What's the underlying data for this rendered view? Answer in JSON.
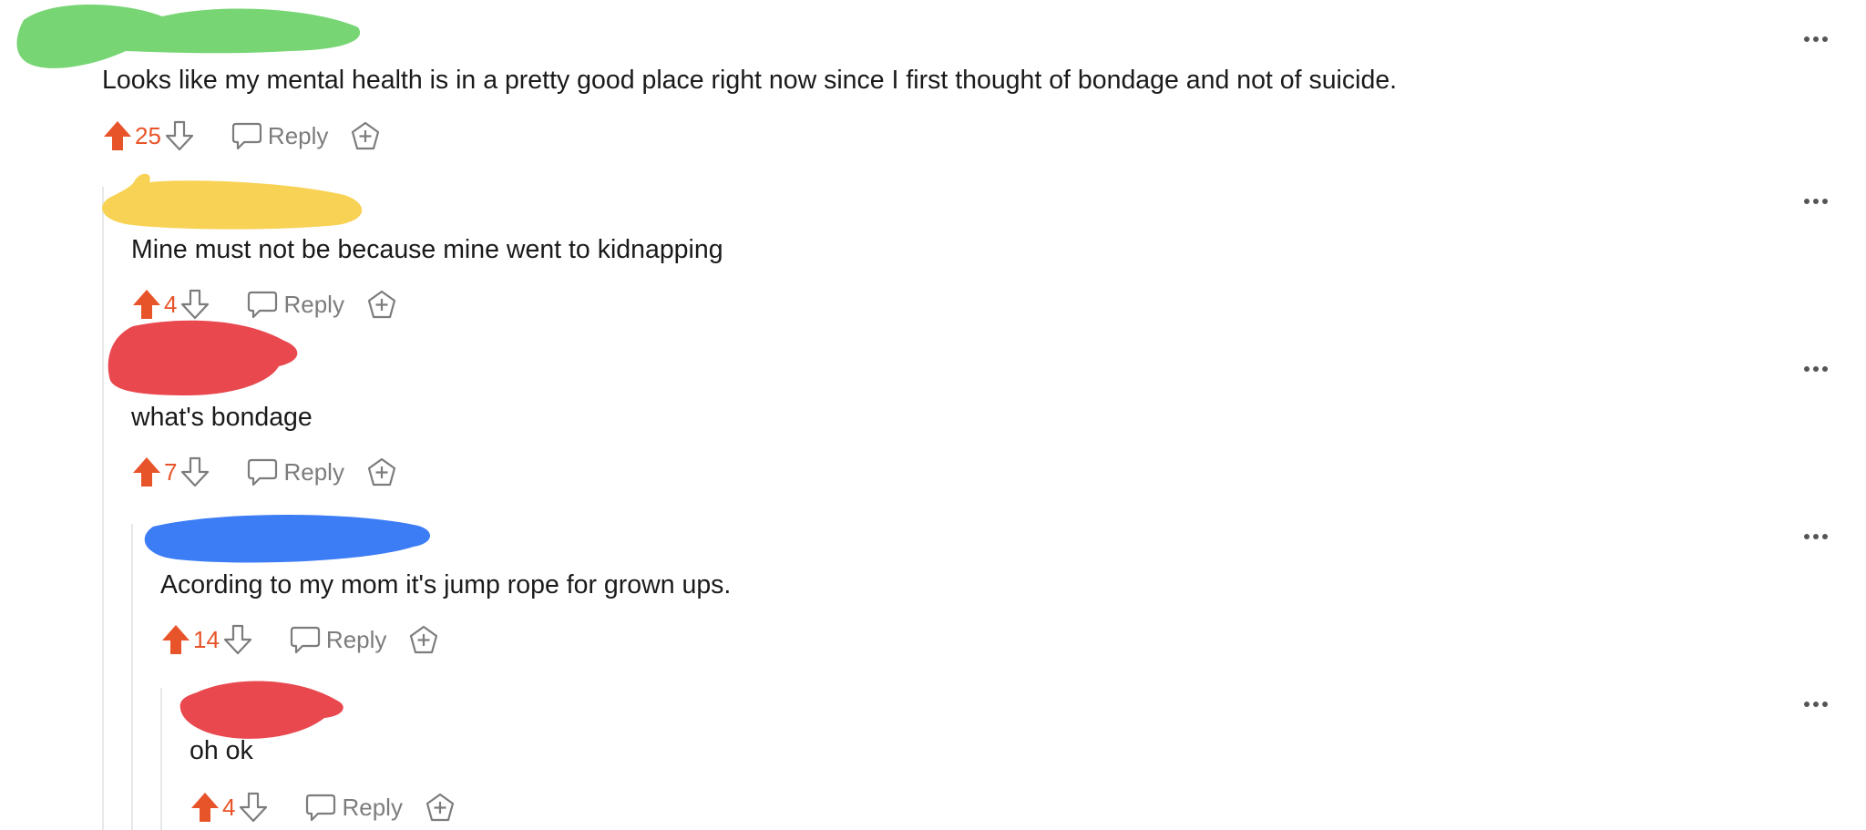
{
  "colors": {
    "upvote": "#e8542a",
    "score": "#e8542a",
    "icon_gray": "#7c7c7c",
    "thread_line": "#e6e8ea",
    "redact_green": "#77d574",
    "redact_yellow": "#f8d255",
    "redact_red": "#e8484e",
    "redact_blue": "#3c7cf4"
  },
  "comments": [
    {
      "text": "Looks like my mental health is in a pretty good place right now since I first thought of bondage and not of suicide.",
      "score": "25",
      "reply_label": "Reply"
    },
    {
      "text": "Mine must not be because mine went to kidnapping",
      "score": "4",
      "reply_label": "Reply"
    },
    {
      "text": "what's bondage",
      "score": "7",
      "reply_label": "Reply"
    },
    {
      "text": "Acording to my mom it's jump rope for grown ups.",
      "score": "14",
      "reply_label": "Reply"
    },
    {
      "text": "oh ok",
      "score": "4",
      "reply_label": "Reply"
    }
  ],
  "icons": [
    "upvote-icon",
    "downvote-icon",
    "reply-bubble-icon",
    "award-icon",
    "more-options-icon"
  ]
}
